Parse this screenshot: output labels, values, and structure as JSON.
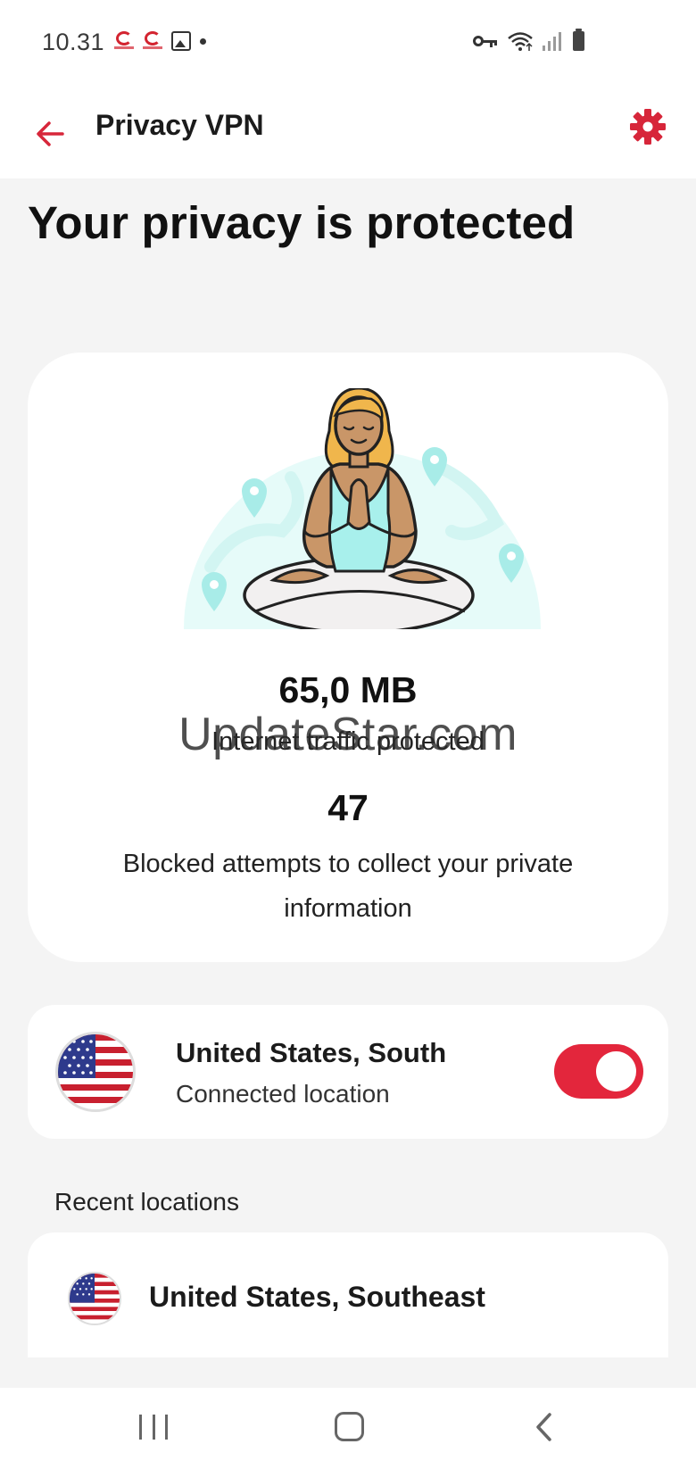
{
  "status_bar": {
    "time": "10.31",
    "left_icons": [
      "secure-app-icon",
      "secure-app-icon",
      "image-icon",
      "dot-icon"
    ],
    "right_icons": [
      "vpn-key-icon",
      "wifi-icon",
      "signal-icon",
      "battery-icon"
    ]
  },
  "app_bar": {
    "title": "Privacy VPN",
    "back_icon": "back-arrow-icon",
    "settings_icon": "gear-icon"
  },
  "heading": "Your privacy is protected",
  "stats": {
    "traffic_value": "65,0  MB",
    "traffic_label": "Internet traffic protected",
    "blocked_value": "47",
    "blocked_label": "Blocked attempts to collect your private information"
  },
  "watermark": "UpdateStar.com",
  "connection": {
    "location": "United States, South",
    "status": "Connected location",
    "enabled": true
  },
  "recent": {
    "heading": "Recent locations",
    "items": [
      {
        "location": "United States, Southeast"
      }
    ]
  },
  "nav_bar": [
    "recents-icon",
    "home-icon",
    "back-icon"
  ],
  "colors": {
    "accent": "#e3263c",
    "background": "#f4f4f4",
    "card": "#ffffff",
    "illustration_tint": "#e6fbf9",
    "pin": "#a8ece8"
  }
}
